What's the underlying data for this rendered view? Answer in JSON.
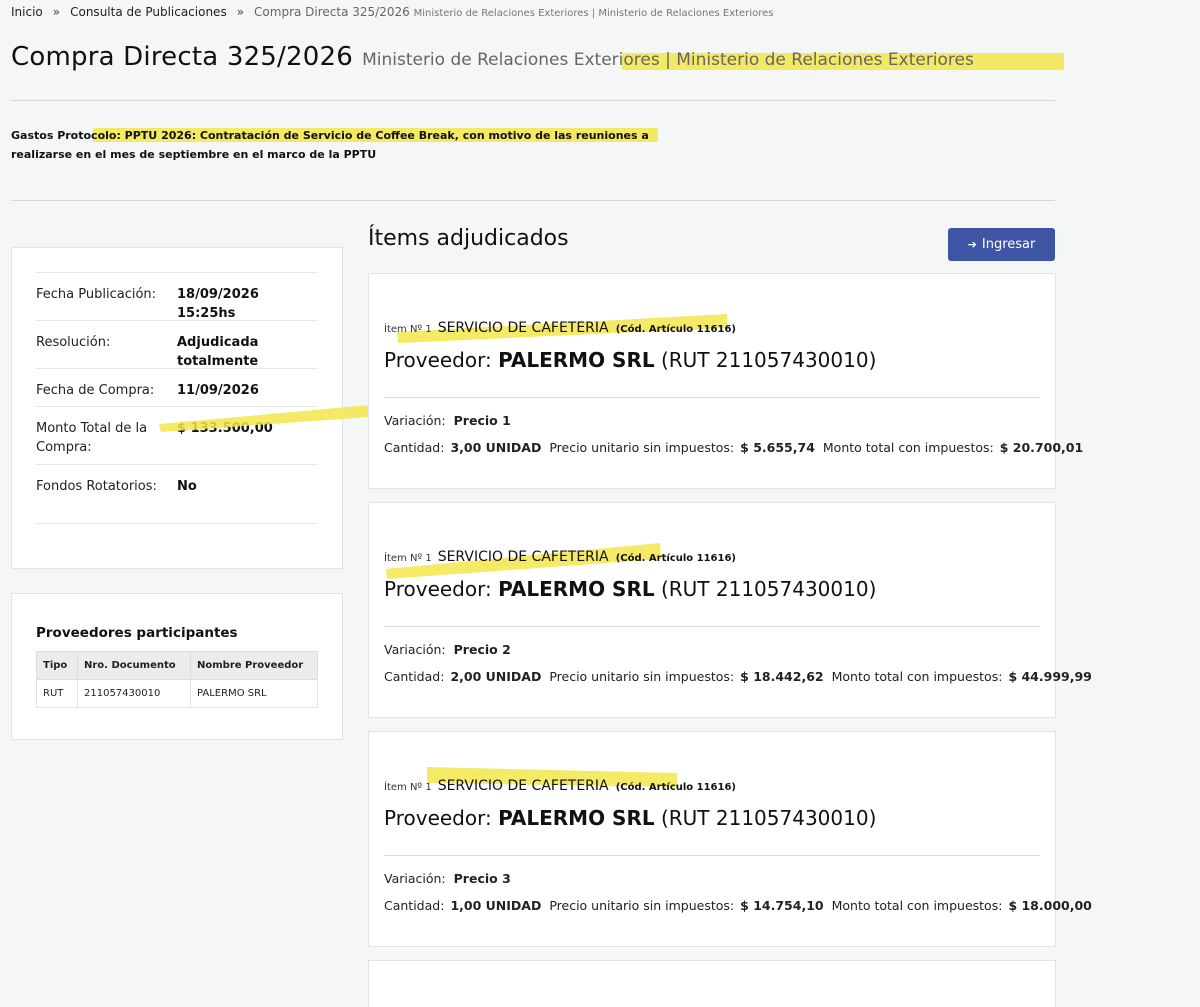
{
  "breadcrumb": {
    "home": "Inicio",
    "sep": "»",
    "section": "Consulta de Publicaciones",
    "current": "Compra Directa 325/2026",
    "current_sub": "Ministerio de Relaciones Exteriores | Ministerio de Relaciones Exteriores"
  },
  "header": {
    "title": "Compra Directa 325/2026",
    "subtitle": "Ministerio de Relaciones Exteriores | Ministerio de Relaciones Exteriores"
  },
  "description": "Gastos Protocolo: PPTU 2026: Contratación de Servicio de Coffee Break, con motivo de las reuniones a realizarse en el mes de septiembre en el marco de la PPTU",
  "info": {
    "fecha_publicacion_label": "Fecha Publicación:",
    "fecha_publicacion": "18/09/2026 15:25hs",
    "resolucion_label": "Resolución:",
    "resolucion": "Adjudicada totalmente",
    "fecha_compra_label": "Fecha de Compra:",
    "fecha_compra": "11/09/2026",
    "monto_total_label": "Monto Total de la Compra:",
    "monto_total": "$ 133.500,00",
    "fondos_label": "Fondos Rotatorios:",
    "fondos": "No"
  },
  "providers": {
    "title": "Proveedores participantes",
    "columns": [
      "Tipo",
      "Nro. Documento",
      "Nombre Proveedor"
    ],
    "rows": [
      [
        "RUT",
        "211057430010",
        "PALERMO SRL"
      ]
    ]
  },
  "items_heading": "Ítems adjudicados",
  "login_button": "Ingresar",
  "labels": {
    "variacion": "Variación:",
    "cantidad": "Cantidad:",
    "precio_unitario": "Precio unitario sin impuestos:",
    "monto_total": "Monto total con impuestos:",
    "proveedor": "Proveedor:"
  },
  "items": [
    {
      "num": "Ítem Nº 1",
      "name": "SERVICIO DE CAFETERIA",
      "cod": "(Cód. Artículo 11616)",
      "provider_name": "PALERMO SRL",
      "provider_rut": "(RUT 211057430010)",
      "variacion": "Precio 1",
      "cantidad": "3,00 UNIDAD",
      "precio_unitario": "$ 5.655,74",
      "monto_total": "$ 20.700,01"
    },
    {
      "num": "Ítem Nº 1",
      "name": "SERVICIO DE CAFETERIA",
      "cod": "(Cód. Artículo 11616)",
      "provider_name": "PALERMO SRL",
      "provider_rut": "(RUT 211057430010)",
      "variacion": "Precio 2",
      "cantidad": "2,00 UNIDAD",
      "precio_unitario": "$ 18.442,62",
      "monto_total": "$ 44.999,99"
    },
    {
      "num": "Ítem Nº 1",
      "name": "SERVICIO DE CAFETERIA",
      "cod": "(Cód. Artículo 11616)",
      "provider_name": "PALERMO SRL",
      "provider_rut": "(RUT 211057430010)",
      "variacion": "Precio 3",
      "cantidad": "1,00 UNIDAD",
      "precio_unitario": "$ 14.754,10",
      "monto_total": "$ 18.000,00"
    }
  ],
  "colors": {
    "highlight": "#f2e64a",
    "button": "#3f55a4",
    "background": "#f5f6f6"
  }
}
